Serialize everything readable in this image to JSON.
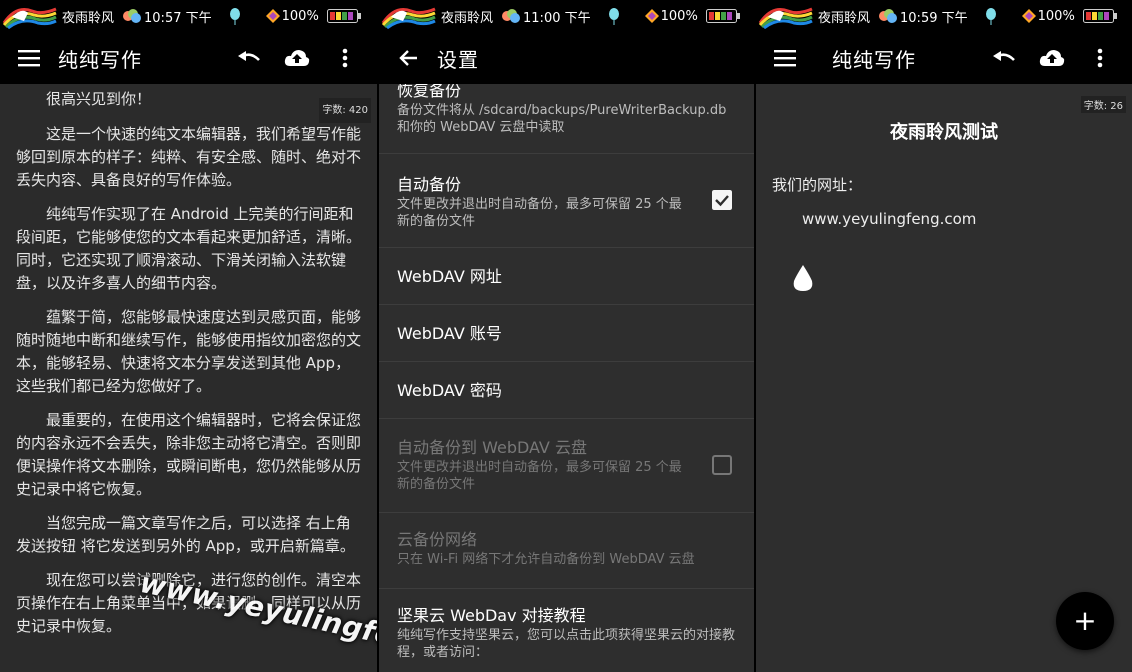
{
  "status_bar": {
    "carrier": "夜雨聆风",
    "battery_pct": "100%",
    "panels": [
      {
        "time": "10:57 下午"
      },
      {
        "time": "11:00 下午"
      },
      {
        "time": "10:59 下午"
      }
    ]
  },
  "editor_screen": {
    "title": "纯纯写作",
    "word_count": "字数: 420",
    "paragraphs": [
      "很高兴见到你！",
      "这是一个快速的纯文本编辑器，我们希望写作能够回到原本的样子：纯粹、有安全感、随时、绝对不丢失内容、具备良好的写作体验。",
      "纯纯写作实现了在 Android 上完美的行间距和段间距，它能够使您的文本看起来更加舒适，清晰。同时，它还实现了顺滑滚动、下滑关闭输入法软键盘，以及许多喜人的细节内容。",
      "蕴繁于简，您能够最快速度达到灵感页面，能够随时随地中断和继续写作，能够使用指纹加密您的文本，能够轻易、快速将文本分享发送到其他 App，这些我们都已经为您做好了。",
      "最重要的，在使用这个编辑器时，它将会保证您的内容永远不会丢失，除非您主动将它清空。否则即便误操作将文本删除，或瞬间断电，您仍然能够从历史记录中将它恢复。",
      "当您完成一篇文章写作之后，可以选择 右上角发送按钮 将它发送到另外的 App，或开启新篇章。",
      "现在您可以尝试删除它，进行您的创作。清空本页操作在右上角菜单当中，如果误删，同样可以从历史记录中恢复。"
    ],
    "watermark": "www.yeyulingfeng.com"
  },
  "settings_screen": {
    "title": "设置",
    "items": [
      {
        "title": "恢复备份",
        "subtitle": "备份文件将从 /sdcard/backups/PureWriterBackup.db 和你的 WebDAV 云盘中读取"
      },
      {
        "title": "自动备份",
        "subtitle": "文件更改并退出时自动备份，最多可保留 25 个最新的备份文件",
        "checked": true
      },
      {
        "title": "WebDAV 网址"
      },
      {
        "title": "WebDAV 账号"
      },
      {
        "title": "WebDAV 密码"
      },
      {
        "title": "自动备份到 WebDAV 云盘",
        "subtitle": "文件更改并退出时自动备份，最多可保留 25 个最新的备份文件",
        "checked": false,
        "disabled": true
      },
      {
        "title": "云备份网络",
        "subtitle": "只在 Wi-Fi 网络下才允许自动备份到 WebDAV 云盘",
        "disabled": true
      },
      {
        "title": "坚果云 WebDav 对接教程",
        "subtitle": "纯纯写作支持坚果云，您可以点击此项获得坚果云的对接教程，或者访问："
      }
    ]
  },
  "document_screen": {
    "title": "纯纯写作",
    "word_count": "字数: 26",
    "doc_title": "夜雨聆风测试",
    "label": "我们的网址：",
    "url": "www.yeyulingfeng.com",
    "fab_label": "+"
  },
  "colors": {
    "bar_bg": "#000000",
    "editor_bg": "#2b2b2b",
    "settings_bg": "#2e2e2e",
    "text_primary": "#ffffff",
    "text_secondary": "#bdbdbd",
    "text_disabled": "#777777",
    "check_bg": "#f5f5f5"
  },
  "icons": {
    "menu": "menu-icon",
    "undo": "undo-icon",
    "cloud_upload": "cloud-upload-icon",
    "more": "more-vert-icon",
    "back": "arrow-back-icon",
    "checkbox": "checkbox-icon",
    "drop": "water-drop-icon",
    "add": "add-icon"
  }
}
